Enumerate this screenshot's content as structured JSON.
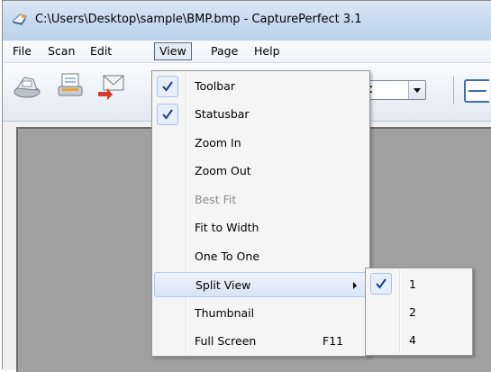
{
  "window": {
    "title": "C:\\Users\\Desktop\\sample\\BMP.bmp - CapturePerfect 3.1",
    "app_icon": "capture-perfect-icon"
  },
  "menubar": {
    "items": [
      {
        "label": "File",
        "active": false
      },
      {
        "label": "Scan",
        "active": false
      },
      {
        "label": "Edit",
        "active": false
      },
      {
        "label": "View",
        "active": true
      },
      {
        "label": "Page",
        "active": false
      },
      {
        "label": "Help",
        "active": false
      }
    ]
  },
  "toolbar": {
    "buttons": [
      {
        "icon": "scanner-icon"
      },
      {
        "icon": "scan-document-icon"
      },
      {
        "icon": "email-icon"
      }
    ],
    "combo_value": "t",
    "right_icon": "fit-width-icon"
  },
  "view_menu": {
    "items": [
      {
        "label": "Toolbar",
        "checked": true,
        "disabled": false,
        "shortcut": "",
        "submenu": false
      },
      {
        "label": "Statusbar",
        "checked": true,
        "disabled": false,
        "shortcut": "",
        "submenu": false
      },
      {
        "label": "Zoom In",
        "checked": false,
        "disabled": false,
        "shortcut": "",
        "submenu": false
      },
      {
        "label": "Zoom Out",
        "checked": false,
        "disabled": false,
        "shortcut": "",
        "submenu": false
      },
      {
        "label": "Best Fit",
        "checked": false,
        "disabled": true,
        "shortcut": "",
        "submenu": false
      },
      {
        "label": "Fit to Width",
        "checked": false,
        "disabled": false,
        "shortcut": "",
        "submenu": false
      },
      {
        "label": "One To One",
        "checked": false,
        "disabled": false,
        "shortcut": "",
        "submenu": false
      },
      {
        "label": "Split View",
        "checked": false,
        "disabled": false,
        "shortcut": "",
        "submenu": true,
        "highlighted": true
      },
      {
        "label": "Thumbnail",
        "checked": false,
        "disabled": false,
        "shortcut": "",
        "submenu": false
      },
      {
        "label": "Full Screen",
        "checked": false,
        "disabled": false,
        "shortcut": "F11",
        "submenu": false
      }
    ]
  },
  "split_submenu": {
    "items": [
      {
        "label": "1",
        "checked": true
      },
      {
        "label": "2",
        "checked": false
      },
      {
        "label": "4",
        "checked": false
      }
    ]
  }
}
